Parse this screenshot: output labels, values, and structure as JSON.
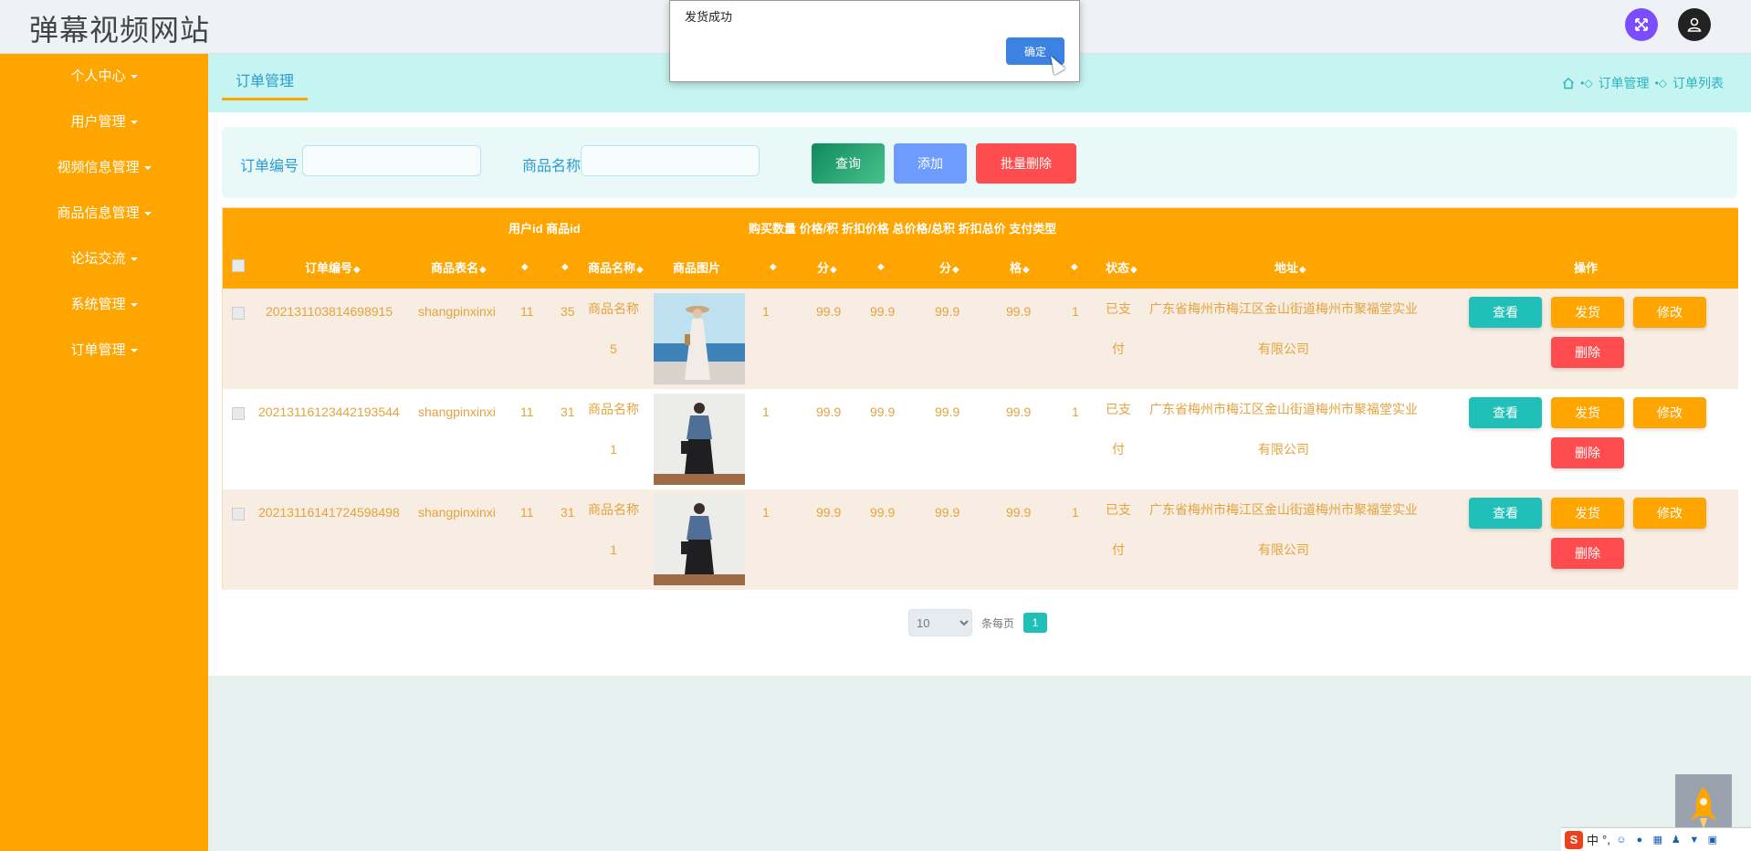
{
  "app": {
    "title": "弹幕视频网站"
  },
  "sidebar": {
    "items": [
      {
        "label": "个人中心"
      },
      {
        "label": "用户管理"
      },
      {
        "label": "视频信息管理"
      },
      {
        "label": "商品信息管理"
      },
      {
        "label": "论坛交流"
      },
      {
        "label": "系统管理"
      },
      {
        "label": "订单管理"
      }
    ]
  },
  "tab": {
    "active": "订单管理"
  },
  "breadcrumb": [
    "订单管理",
    "订单列表"
  ],
  "search": {
    "order_no_label": "订单编号",
    "order_no_value": "",
    "product_name_label": "商品名称",
    "product_name_value": "",
    "query_label": "查询",
    "add_label": "添加",
    "batch_delete_label": "批量删除"
  },
  "table": {
    "header_top": {
      "user_product_ids": "用户id 商品id",
      "rest": "购买数量  价格/积  折扣价格  总价格/总积  折扣总价  支付类型"
    },
    "columns": {
      "order_no": "订单编号",
      "table_name": "商品表名",
      "product_name": "商品名称",
      "image": "商品图片",
      "fen1": "分",
      "fen2": "分",
      "ge": "格",
      "status": "状态",
      "address": "地址",
      "actions": "操作",
      "sort_icon": "◆"
    },
    "rows": [
      {
        "order_no": "202131103814698915",
        "table_name": "shangpinxinxi",
        "user_id": "11",
        "product_id": "35",
        "product_name": "商品名称5",
        "image_desc": "woman-white-dress-beach",
        "qty": "1",
        "price": "99.9",
        "discount_price": "99.9",
        "total": "99.9",
        "discount_total": "99.9",
        "pay_type": "1",
        "status": "已支付",
        "address": "广东省梅州市梅江区金山街道梅州市聚福堂实业有限公司"
      },
      {
        "order_no": "20213116123442193544",
        "table_name": "shangpinxinxi",
        "user_id": "11",
        "product_id": "31",
        "product_name": "商品名称1",
        "image_desc": "woman-denim-jacket-black-skirt",
        "qty": "1",
        "price": "99.9",
        "discount_price": "99.9",
        "total": "99.9",
        "discount_total": "99.9",
        "pay_type": "1",
        "status": "已支付",
        "address": "广东省梅州市梅江区金山街道梅州市聚福堂实业有限公司"
      },
      {
        "order_no": "20213116141724598498",
        "table_name": "shangpinxinxi",
        "user_id": "11",
        "product_id": "31",
        "product_name": "商品名称1",
        "image_desc": "woman-denim-jacket-black-skirt",
        "qty": "1",
        "price": "99.9",
        "discount_price": "99.9",
        "total": "99.9",
        "discount_total": "99.9",
        "pay_type": "1",
        "status": "已支付",
        "address": "广东省梅州市梅江区金山街道梅州市聚福堂实业有限公司"
      }
    ],
    "actions": {
      "view": "查看",
      "ship": "发货",
      "edit": "修改",
      "delete": "删除"
    }
  },
  "pagination": {
    "page_size": "10",
    "per_page_label": "条每页",
    "current_page": "1"
  },
  "dialog": {
    "message": "发货成功",
    "ok_label": "确定"
  },
  "ime": {
    "logo": "S",
    "mode": "中",
    "punct": "°,"
  },
  "colors": {
    "sidebar": "#ffa500",
    "accent": "#2a9ad6",
    "table_header": "#ffa500",
    "teal": "#20c0b9",
    "danger": "#ff4d4f"
  }
}
